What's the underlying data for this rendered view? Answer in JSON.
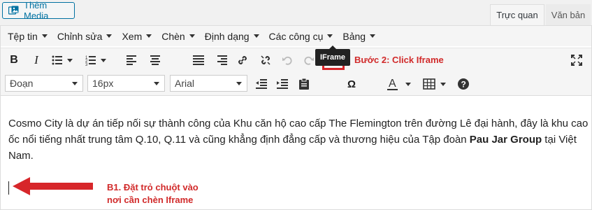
{
  "add_media_label": "Thêm Media",
  "tabs": {
    "visual": "Trực quan",
    "text": "Văn bản"
  },
  "menubar": [
    "Tệp tin",
    "Chỉnh sửa",
    "Xem",
    "Chèn",
    "Định dạng",
    "Các công cụ",
    "Bảng"
  ],
  "toolbar2": {
    "format": "Đoạn",
    "font_size": "16px",
    "font_family": "Arial"
  },
  "iframe_tooltip": "IFrame",
  "annotations": {
    "step2": "Bước 2: Click Iframe",
    "step1_line1": "B1. Đặt trỏ chuột vào",
    "step1_line2": "nơi cần chèn Iframe"
  },
  "content": {
    "text_before": "Cosmo City là dự án tiếp nối sự thành công của Khu căn hộ cao cấp The Flemington trên đường Lê đại hành, đây là khu cao ốc nổi tiếng nhất trung tâm Q.10, Q.11 và cũng khẳng định đẳng cấp và thương hiệu của Tập đoàn ",
    "bold": "Pau Jar Group",
    "text_after": " tại Việt Nam."
  },
  "colors": {
    "accent": "#0071a1",
    "annotation": "#d12a2a",
    "highlight": "#d7262a"
  }
}
